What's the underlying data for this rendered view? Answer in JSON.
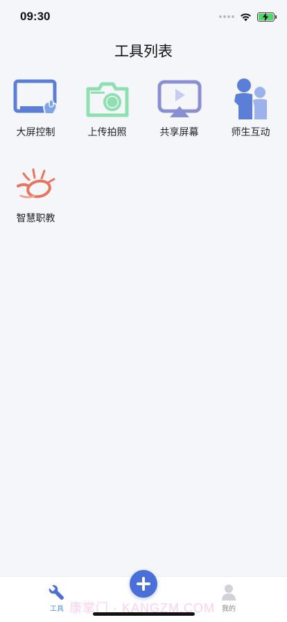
{
  "status": {
    "time": "09:30"
  },
  "page": {
    "title": "工具列表"
  },
  "tools": [
    {
      "label": "大屏控制",
      "icon": "screen-control-icon"
    },
    {
      "label": "上传拍照",
      "icon": "camera-icon"
    },
    {
      "label": "共享屏幕",
      "icon": "screen-share-icon"
    },
    {
      "label": "师生互动",
      "icon": "teacher-student-icon"
    },
    {
      "label": "智慧职教",
      "icon": "smart-vocational-logo-icon"
    }
  ],
  "tabbar": {
    "tools_label": "工具",
    "mine_label": "我的",
    "active_color": "#4a90e2"
  },
  "watermark": "康掌门 · KANGZM.COM",
  "colors": {
    "background": "#f5f6fa",
    "screen_control": "#5b7fd6",
    "camera": "#8ee0b0",
    "screen_share": "#8a8fd4",
    "interaction": "#5b7fd6",
    "logo": "#e8735e",
    "fab": "#4a6fd8"
  }
}
